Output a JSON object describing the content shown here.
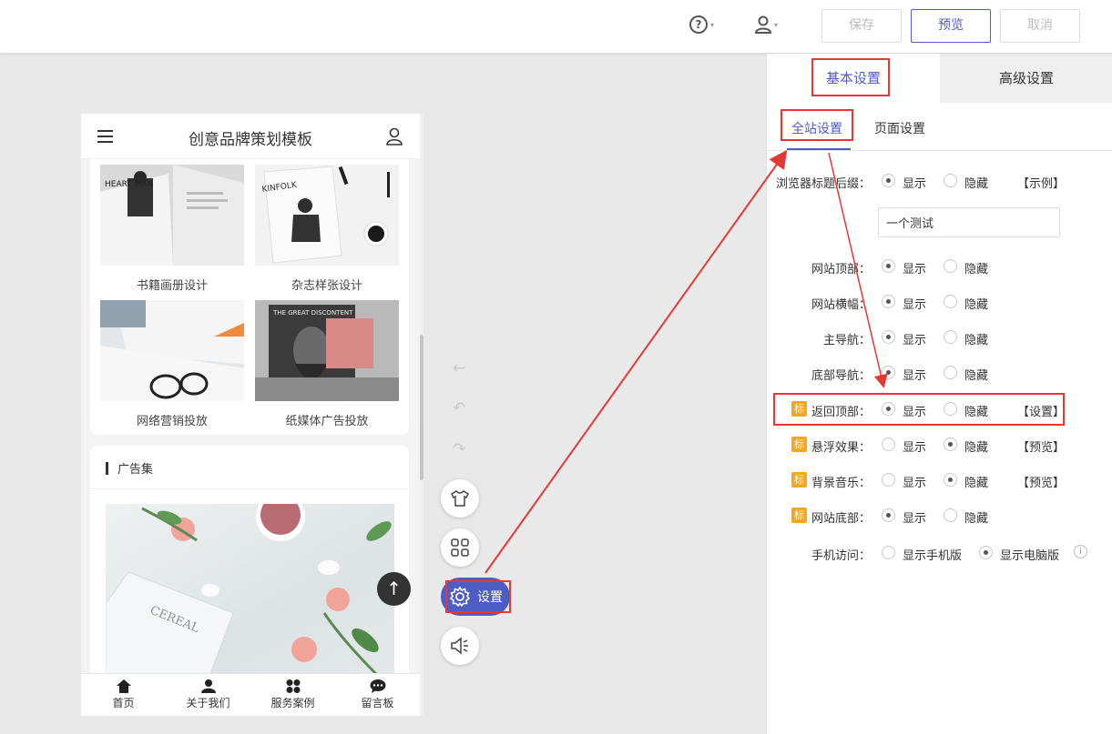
{
  "toolbar": {
    "help_icon": "?",
    "caret": "▾",
    "save_label": "保存",
    "preview_label": "预览",
    "cancel_label": "取消"
  },
  "phone": {
    "title": "创意品牌策划模板",
    "items": [
      {
        "caption": "书籍画册设计",
        "cover_text": "HEART MAN"
      },
      {
        "caption": "杂志样张设计",
        "cover_text": "KINFOLK"
      },
      {
        "caption": "网络营销投放"
      },
      {
        "caption": "纸媒体广告投放",
        "cover_text": "THE GREAT DISCONTENT"
      }
    ],
    "section_title": "广告集",
    "feature_text": "CEREAL",
    "back_to_top": "↑",
    "bottom_nav": [
      "首页",
      "关于我们",
      "服务案例",
      "留言板"
    ]
  },
  "floating": {
    "back_arrow": "←",
    "undo": "↶",
    "redo": "↷",
    "settings_label": "设置"
  },
  "panel": {
    "tabs": [
      "基本设置",
      "高级设置"
    ],
    "subtabs": [
      "全站设置",
      "页面设置"
    ],
    "badge": "标",
    "show": "显示",
    "hide": "隐藏",
    "suffix_label": "浏览器标题后缀：",
    "suffix_link": "【示例】",
    "suffix_value": "一个测试",
    "rows": [
      {
        "label": "网站顶部：",
        "value": "show"
      },
      {
        "label": "网站横幅：",
        "value": "show"
      },
      {
        "label": "主导航：",
        "value": "show"
      },
      {
        "label": "底部导航：",
        "value": "show"
      },
      {
        "label": "返回顶部：",
        "value": "show",
        "link": "【设置】"
      },
      {
        "label": "悬浮效果：",
        "value": "hide",
        "link": "【预览】"
      },
      {
        "label": "背景音乐：",
        "value": "hide",
        "link": "【预览】"
      },
      {
        "label": "网站底部：",
        "value": "show"
      }
    ],
    "mobile_label": "手机访问：",
    "mobile_options": [
      "显示手机版",
      "显示电脑版"
    ],
    "mobile_value": "显示电脑版",
    "info": "i"
  },
  "colors": {
    "accent": "#4e5cc6",
    "highlight": "#e53935",
    "badge": "#f5a623"
  }
}
